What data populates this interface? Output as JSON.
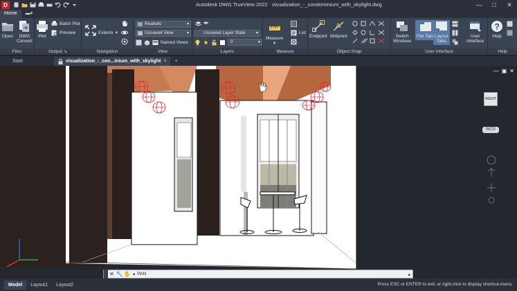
{
  "app": {
    "title": "Autodesk DWG TrueView 2022",
    "document": "visualization_-_condominium_with_skylight.dwg",
    "logo_letter": "D"
  },
  "ribbon_tabs": [
    "Home",
    "▬▾"
  ],
  "panels": {
    "files": {
      "label": "Files",
      "open": "Open",
      "dwg_convert_1": "DWG",
      "dwg_convert_2": "Convert"
    },
    "output": {
      "label": "Output",
      "plot": "Plot",
      "batch_plot": "Batch Plot",
      "preview": "Preview"
    },
    "navigation": {
      "label": "Navigation",
      "extents": "Extents"
    },
    "view": {
      "label": "View",
      "visual_style": "Realistic",
      "saved_view": "Unsaved View",
      "named_views": "Named Views"
    },
    "layers": {
      "label": "Layers",
      "layer_state": "Unsaved Layer State",
      "current_layer": "0"
    },
    "measure": {
      "label": "Measure",
      "measure": "Measure",
      "list": "List"
    },
    "object_snap": {
      "label": "Object Snap",
      "endpoint": "Endpoint",
      "midpoint": "Midpoint"
    },
    "user_interface": {
      "label": "User Interface",
      "switch_windows_1": "Switch",
      "switch_windows_2": "Windows",
      "file_tabs": "File Tabs",
      "layout_tabs_1": "Layout",
      "layout_tabs_2": "Tabs",
      "user_interface_1": "User",
      "user_interface_2": "Interface"
    },
    "help": {
      "label": "Help",
      "help": "Help"
    }
  },
  "file_tabs": {
    "start": "Start",
    "active": "visualization_-_con...inium_with_skylight",
    "close": "×",
    "add": "+"
  },
  "viewport": {
    "viewcube_face": "RIGHT",
    "wcs": "WCS"
  },
  "command_line": {
    "prompt": "PAN",
    "prompt_marker": "▾"
  },
  "layout_tabs": [
    "Model",
    "Layout1",
    "Layout2"
  ],
  "status_message": "Press ESC or ENTER to exit, or right-click to display shortcut-menu.",
  "colors": {
    "ribbon_bg": "#3b4453",
    "title_bg": "#2b303a",
    "wall_white": "#ffffff",
    "beam_orange": "#c67a4f",
    "lamp_red": "#e0272b",
    "logo_red": "#c4262e"
  }
}
